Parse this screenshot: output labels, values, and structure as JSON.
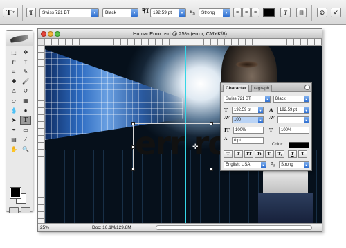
{
  "options_bar": {
    "font_family": "Swiss 721 BT",
    "font_style": "Black",
    "font_size": "192.59 pt",
    "antialias_prefix": "a",
    "antialias_sub": "a",
    "antialias": "Strong"
  },
  "tools_panel": {
    "tools": [
      "marquee",
      "move",
      "lasso",
      "magic-wand",
      "crop",
      "slice",
      "healing",
      "brush",
      "stamp",
      "history-brush",
      "eraser",
      "gradient",
      "blur",
      "dodge",
      "path-select",
      "type",
      "pen",
      "shape",
      "notes",
      "eyedropper",
      "hand",
      "zoom"
    ],
    "active_tool": "type",
    "foreground_color": "#000000",
    "background_color": "#ffffff"
  },
  "document": {
    "title": "HumanError.psd @ 25% (error, CMYK/8)",
    "canvas_text": "err ro",
    "zoom": "25%",
    "doc_info": "Doc: 16.1M/129.8M",
    "guide_color": "#35d6e6"
  },
  "character_panel": {
    "tab_character": "Character",
    "tab_paragraph": "ragraph",
    "font_family": "Swiss 721 BT",
    "font_style": "Black",
    "font_size": "192.59 pt",
    "leading": "192.59 pt",
    "kerning": "100",
    "tracking": "",
    "vertical_scale": "100%",
    "horizontal_scale": "100%",
    "baseline_shift": "0 pt",
    "color_label": "Color:",
    "color": "#000000",
    "style_buttons": [
      "T",
      "T",
      "TT",
      "Tt",
      "T¹",
      "T₁",
      "T",
      "T"
    ],
    "language": "English: USA",
    "antialias_prefix": "a",
    "antialias_sub": "a",
    "antialias": "Strong"
  }
}
